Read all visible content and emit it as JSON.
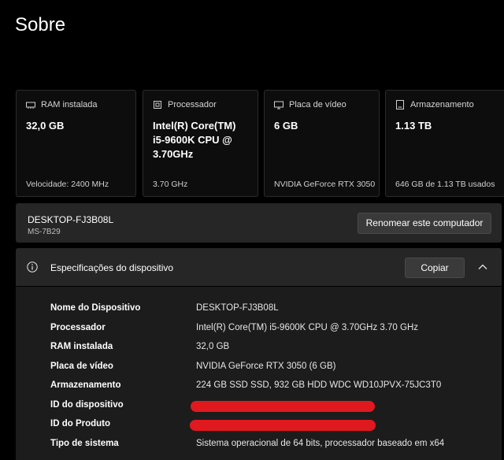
{
  "page": {
    "title": "Sobre"
  },
  "cards": [
    {
      "icon": "ram-icon",
      "label": "RAM instalada",
      "value": "32,0 GB",
      "sub": "Velocidade: 2400 MHz"
    },
    {
      "icon": "processor-icon",
      "label": "Processador",
      "value": "Intel(R) Core(TM) i5-9600K CPU @ 3.70GHz",
      "sub": "3.70 GHz"
    },
    {
      "icon": "gpu-icon",
      "label": "Placa de vídeo",
      "value": "6 GB",
      "sub": "NVIDIA GeForce RTX 3050"
    },
    {
      "icon": "storage-icon",
      "label": "Armazenamento",
      "value": "1.13 TB",
      "sub": "646 GB de 1.13 TB usados"
    }
  ],
  "device": {
    "name": "DESKTOP-FJ3B08L",
    "model": "MS-7B29",
    "rename_label": "Renomear este computador"
  },
  "specs": {
    "title": "Especificações do dispositivo",
    "copy_label": "Copiar",
    "rows": [
      {
        "label": "Nome do Dispositivo",
        "value": "DESKTOP-FJ3B08L"
      },
      {
        "label": "Processador",
        "value": "Intel(R) Core(TM) i5-9600K CPU @ 3.70GHz   3.70 GHz"
      },
      {
        "label": "RAM instalada",
        "value": "32,0 GB"
      },
      {
        "label": "Placa de vídeo",
        "value": "NVIDIA GeForce RTX 3050 (6 GB)"
      },
      {
        "label": "Armazenamento",
        "value": "224 GB SSD SSD, 932 GB HDD WDC WD10JPVX-75JC3T0"
      },
      {
        "label": "ID do dispositivo",
        "value": ""
      },
      {
        "label": "ID do Produto",
        "value": ""
      },
      {
        "label": "Tipo de sistema",
        "value": "Sistema operacional de 64 bits, processador baseado em x64"
      }
    ]
  },
  "colors": {
    "background": "#000000",
    "card_bg": "#0d0d0d",
    "panel_bg": "#262626",
    "body_bg": "#1c1c1c",
    "redaction": "#e0191e"
  }
}
